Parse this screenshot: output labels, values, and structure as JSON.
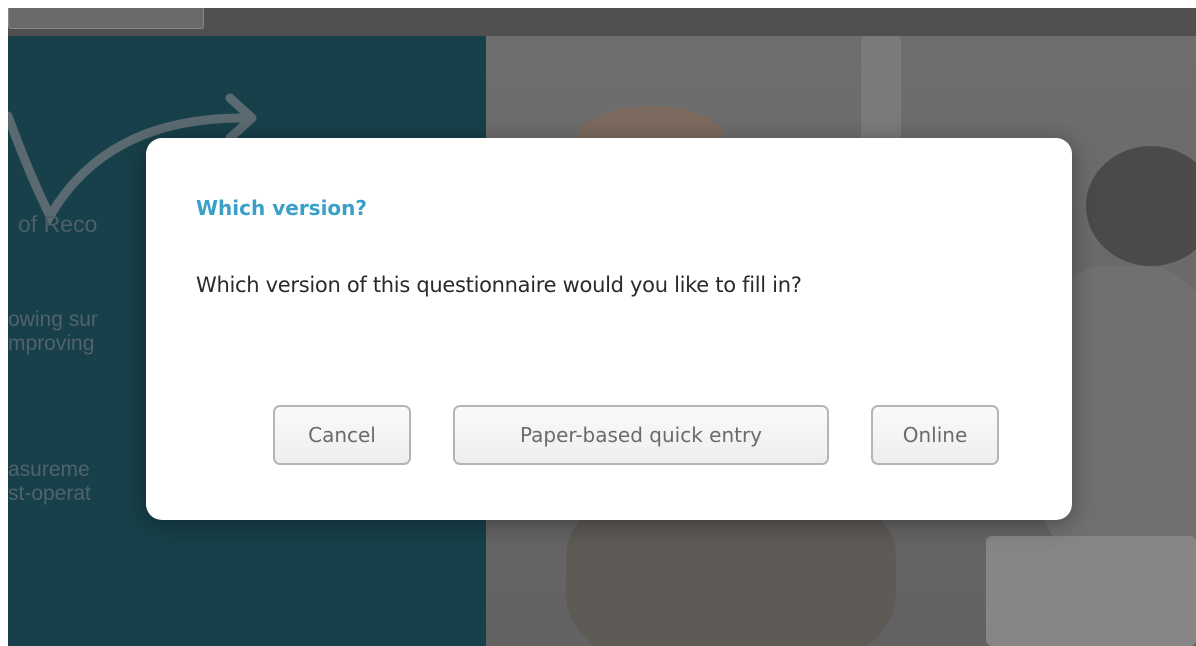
{
  "background": {
    "left_panel_text": {
      "line1": "of Reco",
      "line2": "owing sur",
      "line3": "mproving",
      "line4": "asureme",
      "line5": "st-operat"
    },
    "left_panel_color": "#17404a"
  },
  "dialog": {
    "title": "Which version?",
    "message": "Which version of this questionnaire would you like to fill in?",
    "buttons": {
      "cancel": "Cancel",
      "paper": "Paper-based quick entry",
      "online": "Online"
    },
    "title_color": "#3aa0c8"
  }
}
